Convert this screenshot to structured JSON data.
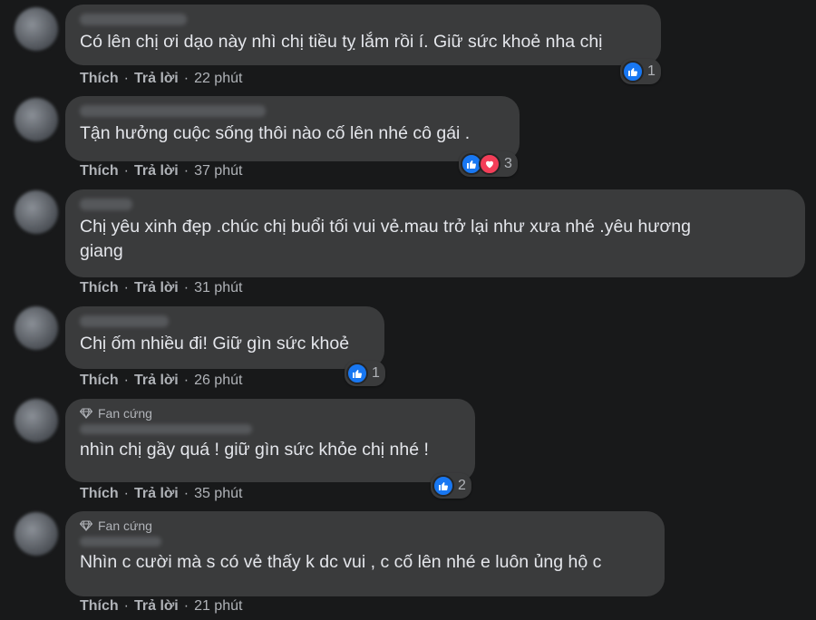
{
  "actions": {
    "like": "Thích",
    "reply": "Trả lời",
    "sep": "·"
  },
  "comments": [
    {
      "text": "Có lên chị ơi dạo này nhì chị tiều tỵ lắm rồi í. Giữ sức khoẻ nha chị",
      "reactions": "1",
      "reaction_types": [
        "like"
      ],
      "time": "22 phút"
    },
    {
      "text": "Tận hưởng cuộc sống thôi nào cố lên nhé cô gái .",
      "reactions": "3",
      "reaction_types": [
        "like",
        "love"
      ],
      "time": "37 phút"
    },
    {
      "text": "Chị yêu xinh đẹp .chúc chị buổi tối vui vẻ.mau trở lại như xưa nhé .yêu hương\ngiang",
      "reactions": "",
      "reaction_types": [],
      "time": "31 phút"
    },
    {
      "text": "Chị ốm nhiều đi! Giữ gìn sức khoẻ",
      "reactions": "1",
      "reaction_types": [
        "like"
      ],
      "time": "26 phút"
    },
    {
      "badge": "Fan cứng",
      "text": "nhìn chị gầy quá ! giữ gìn sức khỏe chị nhé !",
      "reactions": "2",
      "reaction_types": [
        "like"
      ],
      "time": "35 phút"
    },
    {
      "badge": "Fan cứng",
      "text": "Nhìn c cười mà s có vẻ thấy k dc vui , c cố lên nhé e luôn ủng hộ c",
      "reactions": "",
      "reaction_types": [],
      "time": "21 phút"
    }
  ],
  "colors": {
    "background": "#18191a",
    "bubble": "#3a3b3c",
    "like": "#1877f2",
    "love": "#f33e58",
    "muted": "#b0b3b8"
  }
}
